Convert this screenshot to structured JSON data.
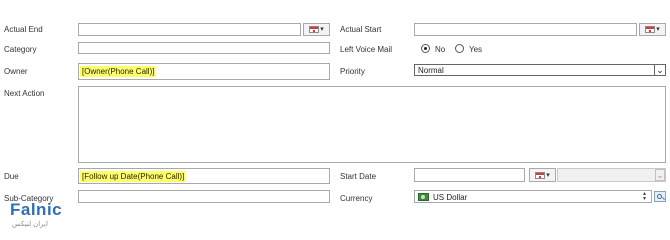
{
  "form": {
    "actual_end": {
      "label": "Actual End",
      "value": ""
    },
    "actual_start": {
      "label": "Actual Start",
      "value": ""
    },
    "category": {
      "label": "Category",
      "value": ""
    },
    "left_voice_mail": {
      "label": "Left Voice Mail",
      "options": [
        "No",
        "Yes"
      ],
      "selected": "No"
    },
    "owner": {
      "label": "Owner",
      "value": "[Owner(Phone Call)]"
    },
    "priority": {
      "label": "Priority",
      "value": "Normal"
    },
    "next_action": {
      "label": "Next Action",
      "value": ""
    },
    "due": {
      "label": "Due",
      "value": "[Follow up Date(Phone Call)]"
    },
    "start_date": {
      "label": "Start Date",
      "value": ""
    },
    "sub_category": {
      "label": "Sub-Category",
      "value": ""
    },
    "currency": {
      "label": "Currency",
      "value": "US Dollar"
    }
  },
  "watermark": {
    "brand": "Falnic",
    "sub": "ایران لنیکس"
  },
  "colors": {
    "highlight": "#ffff66",
    "border": "#a9a9a9",
    "brand_blue": "#2f6fb3",
    "brand_grey": "#8c8c8c"
  }
}
